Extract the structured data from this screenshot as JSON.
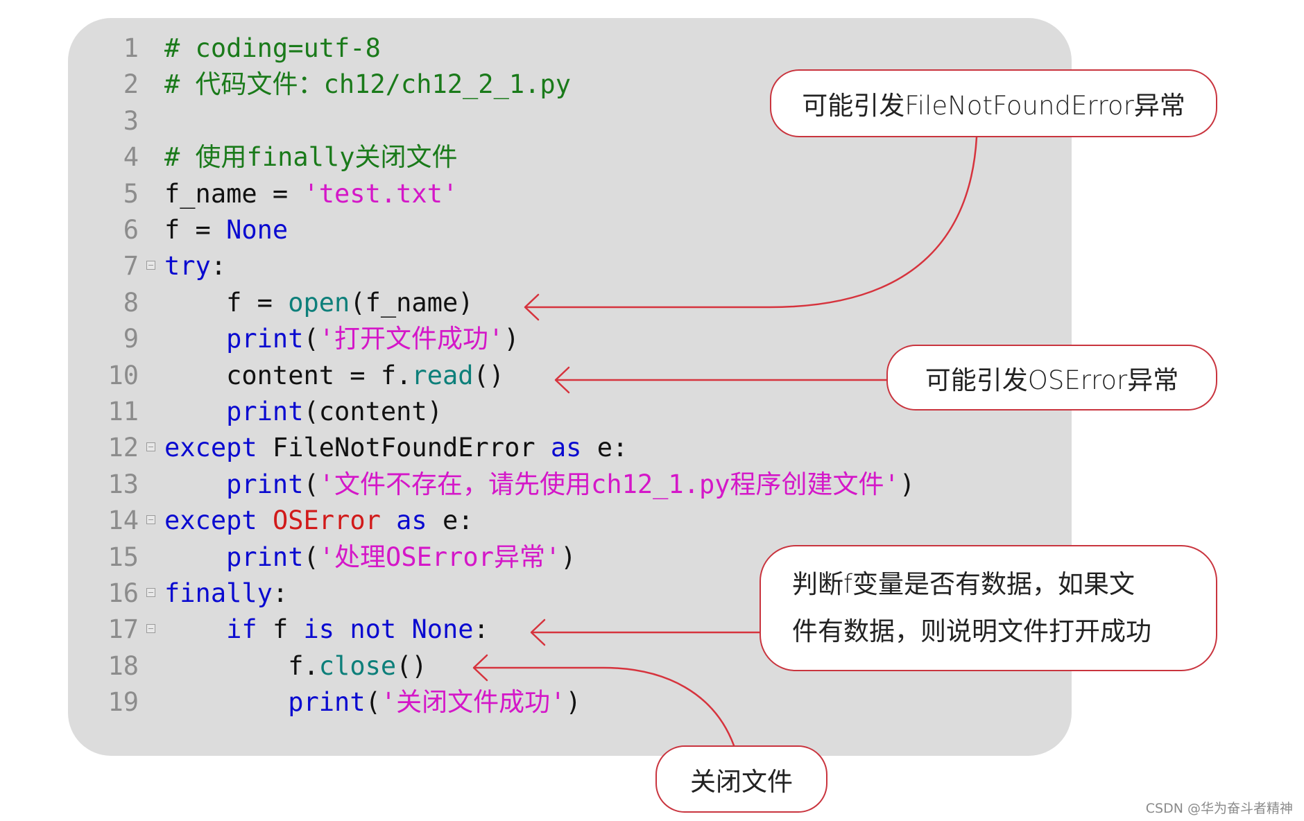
{
  "code": {
    "lines": [
      {
        "n": "1",
        "fold": false,
        "tokens": [
          {
            "t": "# coding=utf-8",
            "c": "comment"
          }
        ]
      },
      {
        "n": "2",
        "fold": false,
        "tokens": [
          {
            "t": "# 代码文件：ch12/ch12_2_1.py",
            "c": "comment"
          }
        ]
      },
      {
        "n": "3",
        "fold": false,
        "tokens": []
      },
      {
        "n": "4",
        "fold": false,
        "tokens": [
          {
            "t": "# 使用finally关闭文件",
            "c": "comment"
          }
        ]
      },
      {
        "n": "5",
        "fold": false,
        "tokens": [
          {
            "t": "f_name = ",
            "c": "plain"
          },
          {
            "t": "'test.txt'",
            "c": "str"
          }
        ]
      },
      {
        "n": "6",
        "fold": false,
        "tokens": [
          {
            "t": "f = ",
            "c": "plain"
          },
          {
            "t": "None",
            "c": "kw"
          }
        ]
      },
      {
        "n": "7",
        "fold": true,
        "tokens": [
          {
            "t": "try",
            "c": "kw"
          },
          {
            "t": ":",
            "c": "plain"
          }
        ]
      },
      {
        "n": "8",
        "fold": false,
        "tokens": [
          {
            "t": "    f = ",
            "c": "plain"
          },
          {
            "t": "open",
            "c": "fn"
          },
          {
            "t": "(f_name)",
            "c": "plain"
          }
        ]
      },
      {
        "n": "9",
        "fold": false,
        "tokens": [
          {
            "t": "    ",
            "c": "plain"
          },
          {
            "t": "print",
            "c": "kw"
          },
          {
            "t": "(",
            "c": "plain"
          },
          {
            "t": "'打开文件成功'",
            "c": "str"
          },
          {
            "t": ")",
            "c": "plain"
          }
        ]
      },
      {
        "n": "10",
        "fold": false,
        "tokens": [
          {
            "t": "    content = f.",
            "c": "plain"
          },
          {
            "t": "read",
            "c": "fn"
          },
          {
            "t": "()",
            "c": "plain"
          }
        ]
      },
      {
        "n": "11",
        "fold": false,
        "tokens": [
          {
            "t": "    ",
            "c": "plain"
          },
          {
            "t": "print",
            "c": "kw"
          },
          {
            "t": "(content)",
            "c": "plain"
          }
        ]
      },
      {
        "n": "12",
        "fold": true,
        "tokens": [
          {
            "t": "except",
            "c": "kw"
          },
          {
            "t": " FileNotFoundError ",
            "c": "plain"
          },
          {
            "t": "as",
            "c": "kw"
          },
          {
            "t": " e:",
            "c": "plain"
          }
        ]
      },
      {
        "n": "13",
        "fold": false,
        "tokens": [
          {
            "t": "    ",
            "c": "plain"
          },
          {
            "t": "print",
            "c": "kw"
          },
          {
            "t": "(",
            "c": "plain"
          },
          {
            "t": "'文件不存在，请先使用ch12_1.py程序创建文件'",
            "c": "str"
          },
          {
            "t": ")",
            "c": "plain"
          }
        ]
      },
      {
        "n": "14",
        "fold": true,
        "tokens": [
          {
            "t": "except",
            "c": "kw"
          },
          {
            "t": " ",
            "c": "plain"
          },
          {
            "t": "OSError",
            "c": "err"
          },
          {
            "t": " ",
            "c": "plain"
          },
          {
            "t": "as",
            "c": "kw"
          },
          {
            "t": " e:",
            "c": "plain"
          }
        ]
      },
      {
        "n": "15",
        "fold": false,
        "tokens": [
          {
            "t": "    ",
            "c": "plain"
          },
          {
            "t": "print",
            "c": "kw"
          },
          {
            "t": "(",
            "c": "plain"
          },
          {
            "t": "'处理OSError异常'",
            "c": "str"
          },
          {
            "t": ")",
            "c": "plain"
          }
        ]
      },
      {
        "n": "16",
        "fold": true,
        "tokens": [
          {
            "t": "finally",
            "c": "kw"
          },
          {
            "t": ":",
            "c": "plain"
          }
        ]
      },
      {
        "n": "17",
        "fold": true,
        "tokens": [
          {
            "t": "    ",
            "c": "plain"
          },
          {
            "t": "if",
            "c": "kw"
          },
          {
            "t": " f ",
            "c": "plain"
          },
          {
            "t": "is",
            "c": "kw"
          },
          {
            "t": " ",
            "c": "plain"
          },
          {
            "t": "not",
            "c": "kw"
          },
          {
            "t": " ",
            "c": "plain"
          },
          {
            "t": "None",
            "c": "kw"
          },
          {
            "t": ":",
            "c": "plain"
          }
        ]
      },
      {
        "n": "18",
        "fold": false,
        "tokens": [
          {
            "t": "        f.",
            "c": "plain"
          },
          {
            "t": "close",
            "c": "fn"
          },
          {
            "t": "()",
            "c": "plain"
          }
        ]
      },
      {
        "n": "19",
        "fold": false,
        "tokens": [
          {
            "t": "        ",
            "c": "plain"
          },
          {
            "t": "print",
            "c": "kw"
          },
          {
            "t": "(",
            "c": "plain"
          },
          {
            "t": "'关闭文件成功'",
            "c": "str"
          },
          {
            "t": ")",
            "c": "plain"
          }
        ]
      }
    ]
  },
  "callouts": {
    "file_not_found": "可能引发FileNotFoundError异常",
    "os_error": "可能引发OSError异常",
    "check_f": [
      "判断f变量是否有数据，如果文",
      "件有数据，则说明文件打开成功"
    ],
    "close_file": "关闭文件"
  },
  "colors": {
    "panel_bg": "#dcdcdc",
    "comment": "#1a7a1a",
    "keyword": "#0a0ad0",
    "string": "#d417c8",
    "builtin": "#0d7f7a",
    "exception": "#d11a1a",
    "annotation_border": "#c9343e"
  },
  "watermark": "CSDN @华为奋斗者精神"
}
